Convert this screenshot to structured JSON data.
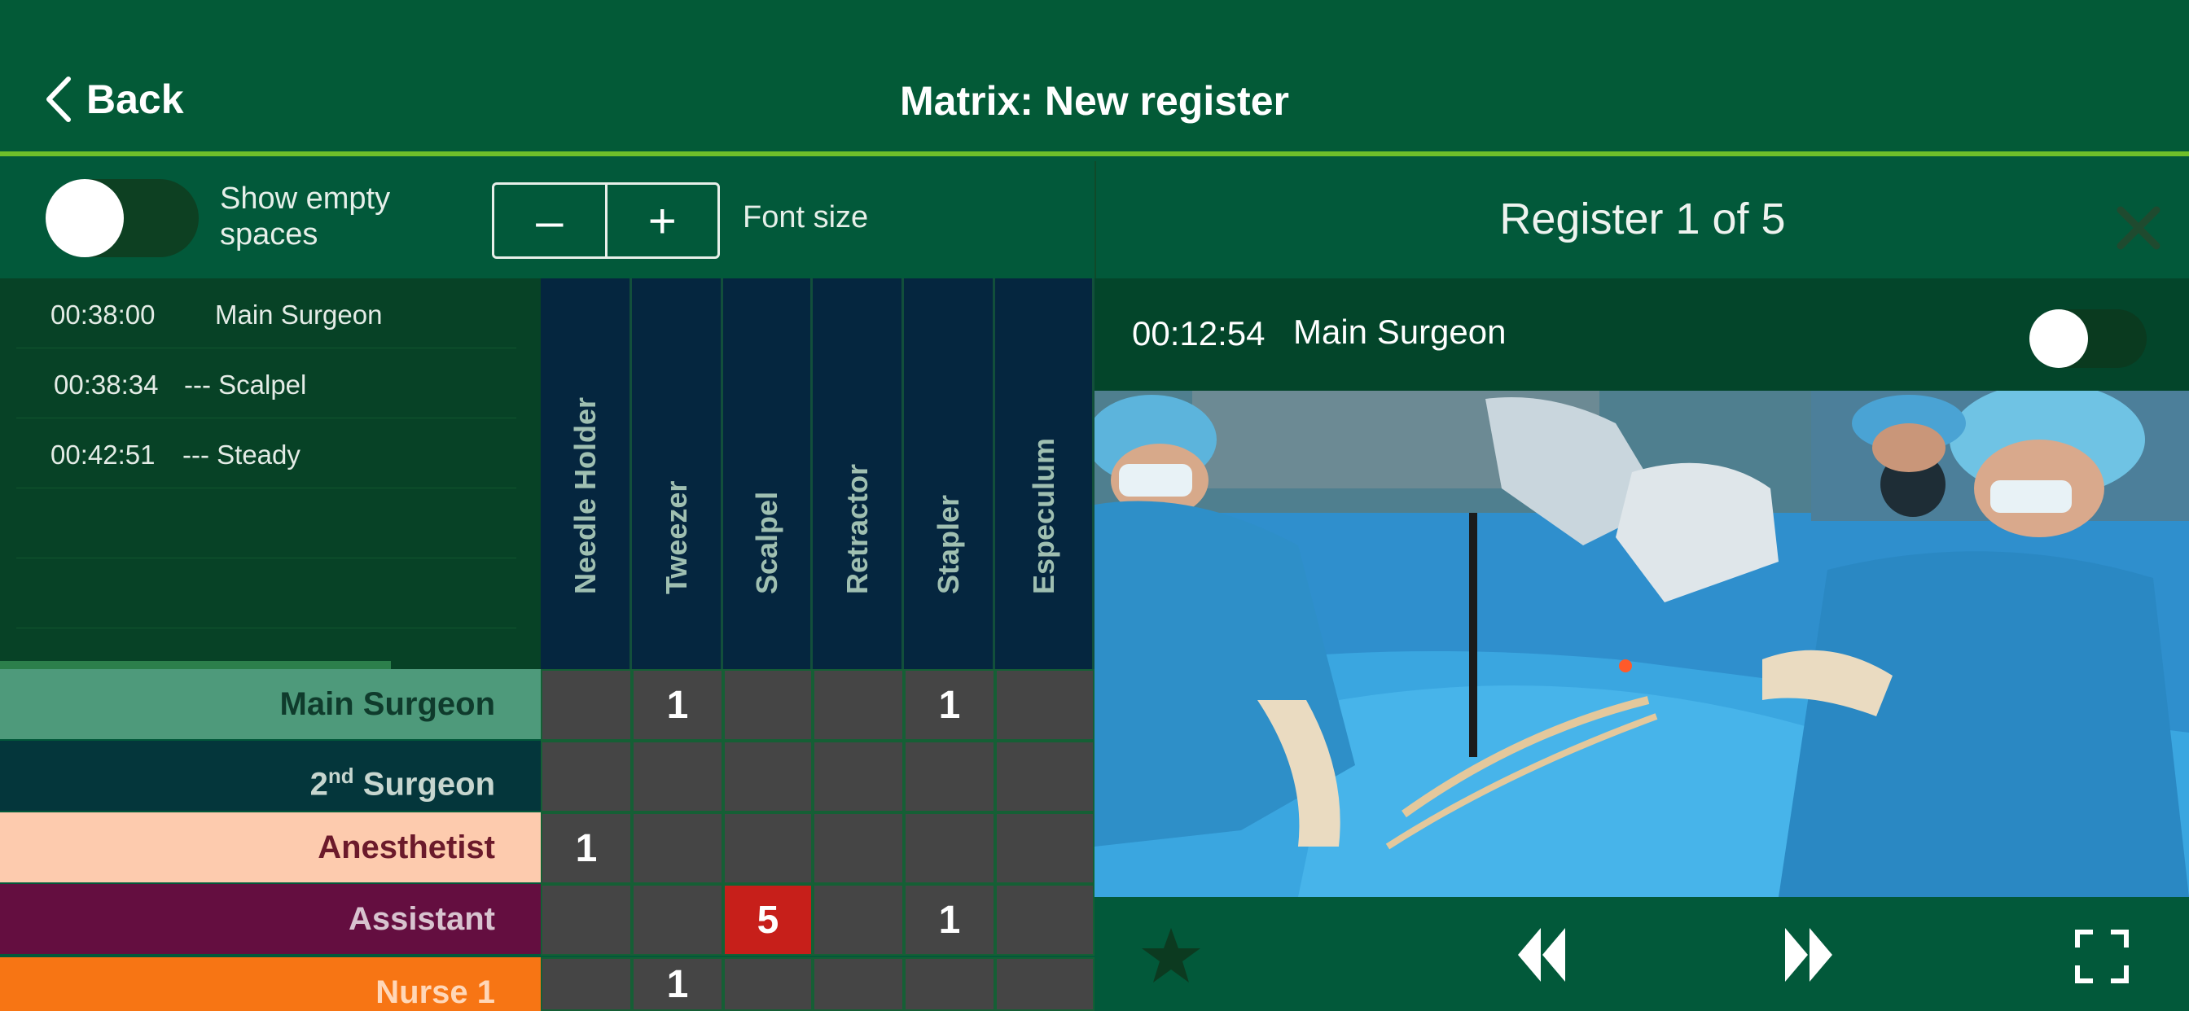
{
  "header": {
    "back_label": "Back",
    "title": "Matrix: New register"
  },
  "controls": {
    "toggle_label": "Show empty spaces",
    "toggle_on": false,
    "minus": "–",
    "plus": "+",
    "font_size_label": "Font size"
  },
  "log": [
    {
      "time": "00:38:00",
      "text": "Main Surgeon"
    },
    {
      "time": "00:38:34",
      "text": "--- Scalpel"
    },
    {
      "time": "00:42:51",
      "text": "--- Steady"
    }
  ],
  "columns": [
    "Needle Holder",
    "Tweezer",
    "Scalpel",
    "Retractor",
    "Stapler",
    "Especulum"
  ],
  "rows": [
    {
      "label": "Main Surgeon",
      "bg": "#4e9a7b",
      "fg": "#0f3b2c",
      "cells": [
        "",
        "1",
        "",
        "",
        "1",
        ""
      ]
    },
    {
      "label": "Surgeon",
      "prefix": "2",
      "sup": "nd",
      "bg": "#04363b",
      "fg": "#c7d6cf",
      "cells": [
        "",
        "",
        "",
        "",
        "",
        ""
      ]
    },
    {
      "label": "Anesthetist",
      "bg": "#fdcbae",
      "fg": "#6b1a2b",
      "cells": [
        "1",
        "",
        "",
        "",
        "",
        ""
      ]
    },
    {
      "label": "Assistant",
      "bg": "#640e40",
      "fg": "#d8c3cf",
      "cells": [
        "",
        "",
        "5",
        "",
        "1",
        ""
      ]
    },
    {
      "label": "Nurse 1",
      "bg": "#f77514",
      "fg": "#ffd7b8",
      "cells": [
        "",
        "1",
        "",
        "",
        "",
        ""
      ]
    }
  ],
  "highlight": {
    "row": 3,
    "col": 2,
    "color": "#c71f1a"
  },
  "player": {
    "title": "Register 1 of 5",
    "time": "00:12:54",
    "role": "Main Surgeon",
    "toggle_on": false,
    "icons": [
      "star-icon",
      "rewind-icon",
      "fast-forward-icon",
      "fullscreen-icon"
    ]
  },
  "colors": {
    "bg": "#02593a",
    "accent": "#6fbf2a",
    "header_col": "#05263f",
    "cell": "#454545"
  }
}
